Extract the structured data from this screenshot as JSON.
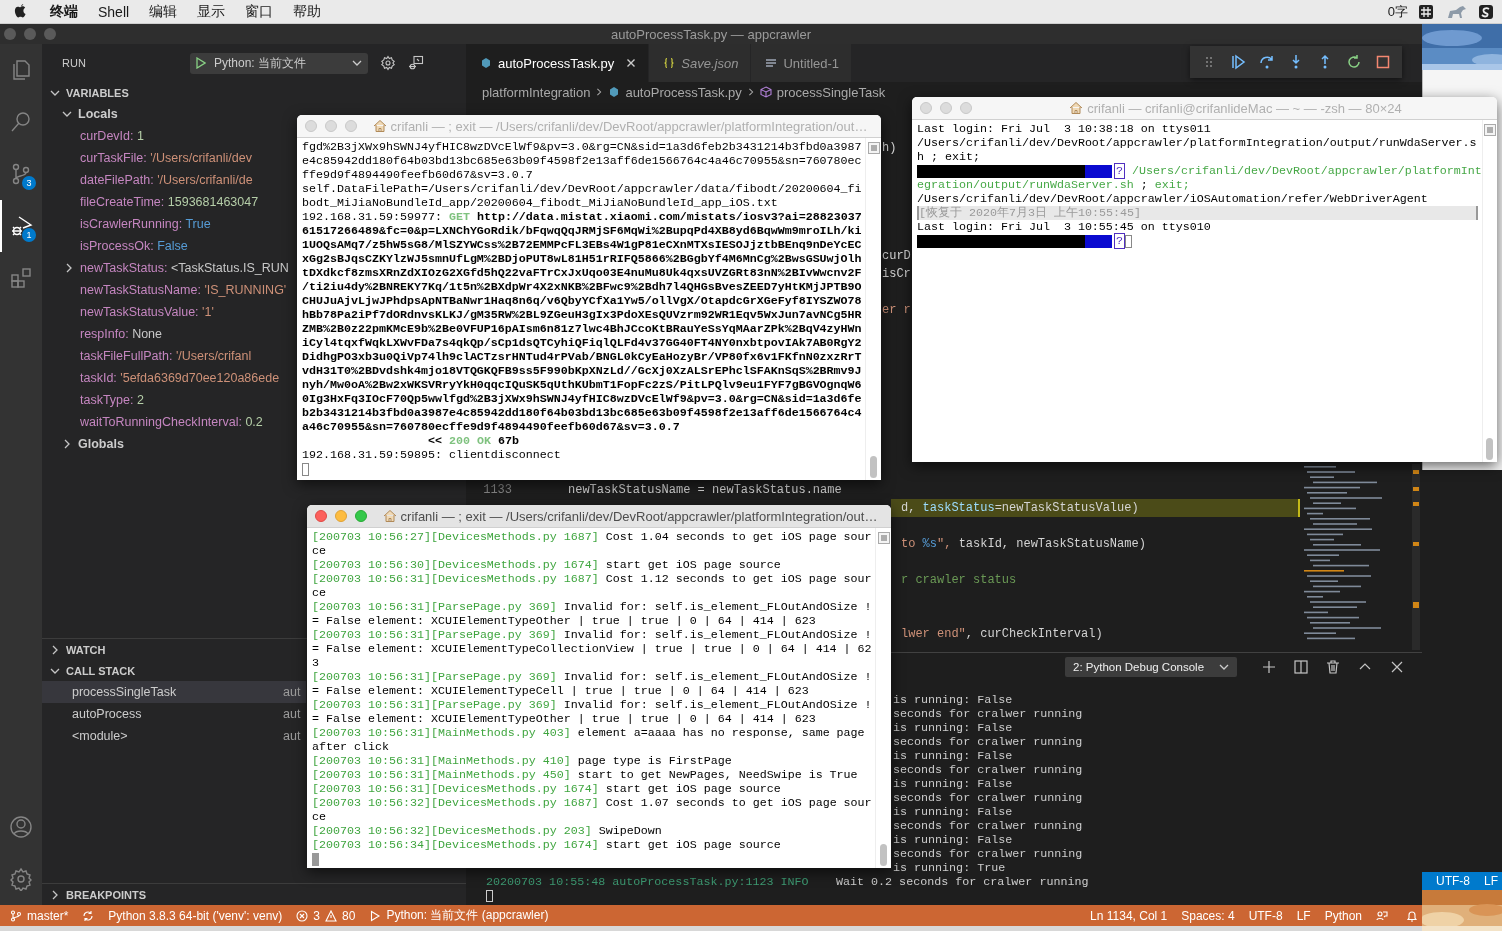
{
  "menu_bar": {
    "app": "终端",
    "items": [
      "Shell",
      "编辑",
      "显示",
      "窗口",
      "帮助"
    ],
    "status_text": "0字"
  },
  "window": {
    "title": "autoProcessTask.py — appcrawler"
  },
  "activity_bar": {
    "items": [
      {
        "kind": "explorer",
        "selected": false
      },
      {
        "kind": "search",
        "selected": false
      },
      {
        "kind": "source-control",
        "badge": "3",
        "selected": false
      },
      {
        "kind": "debug",
        "badge": "1",
        "selected": true
      },
      {
        "kind": "extensions",
        "selected": false
      }
    ],
    "bottom": [
      {
        "kind": "account"
      },
      {
        "kind": "settings"
      }
    ]
  },
  "sidebar": {
    "title": "RUN",
    "launch_config": "Python: 当前文件",
    "variables": {
      "title": "VARIABLES",
      "expanded": true,
      "scopes": [
        {
          "name": "Locals",
          "expanded": true,
          "variables": [
            {
              "name": "curDevId:",
              "value": "1",
              "kind": "number",
              "expandable": false
            },
            {
              "name": "curTaskFile:",
              "value": "'/Users/crifanli/dev",
              "kind": "string",
              "expandable": false
            },
            {
              "name": "dateFilePath:",
              "value": "'/Users/crifanli/de",
              "kind": "string",
              "expandable": false
            },
            {
              "name": "fileCreateTime:",
              "value": "1593681463047",
              "kind": "number",
              "expandable": false
            },
            {
              "name": "isCrawlerRunning:",
              "value": "True",
              "kind": "boolean",
              "expandable": false
            },
            {
              "name": "isProcessOk:",
              "value": "False",
              "kind": "boolean",
              "expandable": false
            },
            {
              "name": "newTaskStatus:",
              "value": "<TaskStatus.IS_RUN",
              "kind": "object",
              "expandable": true,
              "expanded": false
            },
            {
              "name": "newTaskStatusName:",
              "value": "'IS_RUNNING'",
              "kind": "string",
              "expandable": false
            },
            {
              "name": "newTaskStatusValue:",
              "value": "'1'",
              "kind": "string",
              "expandable": false
            },
            {
              "name": "respInfo:",
              "value": "None",
              "kind": "none",
              "expandable": false
            },
            {
              "name": "taskFileFullPath:",
              "value": "'/Users/crifanl",
              "kind": "string",
              "expandable": false
            },
            {
              "name": "taskId:",
              "value": "'5efda6369d70ee120a86ede",
              "kind": "string",
              "expandable": false
            },
            {
              "name": "taskType:",
              "value": "2",
              "kind": "number",
              "expandable": false
            },
            {
              "name": "waitToRunningCheckInterval:",
              "value": "0.2",
              "kind": "number",
              "expandable": false
            }
          ]
        },
        {
          "name": "Globals",
          "expanded": false
        }
      ]
    },
    "watch": {
      "title": "WATCH",
      "expanded": false
    },
    "call_stack": {
      "title": "CALL STACK",
      "expanded": true,
      "frames": [
        {
          "name": "processSingleTask",
          "source": "aut",
          "selected": true
        },
        {
          "name": "autoProcess",
          "source": "aut",
          "selected": false
        },
        {
          "name": "<module>",
          "source": "aut",
          "selected": false
        }
      ]
    },
    "breakpoints": {
      "title": "BREAKPOINTS",
      "expanded": false
    }
  },
  "editor": {
    "tabs": [
      {
        "label": "autoProcessTask.py",
        "kind": "python",
        "selected": true,
        "preview": false
      },
      {
        "label": "Save.json",
        "kind": "json",
        "selected": false,
        "preview": true
      },
      {
        "label": "Untitled-1",
        "kind": "text",
        "selected": false,
        "preview": false
      }
    ],
    "breadcrumb": [
      {
        "label": "platformIntegration",
        "kind": "folder"
      },
      {
        "label": "autoProcessTask.py",
        "kind": "python"
      },
      {
        "label": "processSingleTask",
        "kind": "method"
      }
    ],
    "debug_toolbar": [
      {
        "kind": "grip"
      },
      {
        "kind": "continue"
      },
      {
        "kind": "step-over"
      },
      {
        "kind": "step-into"
      },
      {
        "kind": "step-out"
      },
      {
        "kind": "restart"
      },
      {
        "kind": "stop"
      }
    ],
    "code_lines": [
      {
        "highlighted": false,
        "segments": [
          {
            "text": "h)",
            "kind": "plain"
          }
        ]
      },
      {
        "highlighted": false,
        "segments": [
          {
            "text": "curD",
            "kind": "plain"
          }
        ]
      },
      {
        "highlighted": false,
        "segments": [
          {
            "text": "isCr",
            "kind": "plain"
          }
        ]
      },
      {
        "highlighted": false,
        "segments": [
          {
            "text": "er r",
            "kind": "string"
          }
        ]
      },
      {
        "number": "1133",
        "highlighted": false,
        "segments": [
          {
            "text": "newTaskStatusName = newTaskStatus.name",
            "kind": "plain"
          }
        ]
      },
      {
        "highlighted": true,
        "segments": [
          {
            "text": "d, ",
            "kind": "plain"
          },
          {
            "text": "taskStatus",
            "kind": "param"
          },
          {
            "text": "=newTaskStatusValue)",
            "kind": "plain"
          }
        ]
      },
      {
        "highlighted": false,
        "segments": [
          {
            "text": "to ",
            "kind": "string"
          },
          {
            "text": "%s",
            "kind": "format"
          },
          {
            "text": "\", ",
            "kind": "string"
          },
          {
            "text": "taskId, newTaskStatusName)",
            "kind": "plain"
          }
        ]
      },
      {
        "highlighted": false,
        "segments": [
          {
            "text": "r crawler status",
            "kind": "comment"
          }
        ]
      },
      {
        "highlighted": false,
        "segments": [
          {
            "text": "lwer end\"",
            "kind": "string"
          },
          {
            "text": ", curCheckInterval)",
            "kind": "plain"
          }
        ]
      }
    ]
  },
  "panel": {
    "console_select": "2: Python Debug Console",
    "actions": [
      {
        "kind": "add"
      },
      {
        "kind": "split"
      },
      {
        "kind": "trash"
      },
      {
        "kind": "maximize"
      },
      {
        "kind": "close"
      }
    ],
    "visible_fragments": [
      "is running: False",
      "seconds for cralwer running",
      "is running: False",
      "seconds for cralwer running",
      "is running: False",
      "seconds for cralwer running",
      "is running: False",
      "seconds for cralwer running",
      "is running: False",
      "seconds for cralwer running",
      "is running: False",
      "seconds for cralwer running",
      "is running: True"
    ],
    "lines": [
      {
        "meta": "20200703 10:55:48 autoProcessTask.py:1123 INFO",
        "text": "Wait 0.2 seconds for cralwer running"
      }
    ],
    "cursor": true
  },
  "status_bar": {
    "left": [
      {
        "kind": "branch",
        "text": "master*"
      },
      {
        "kind": "sync"
      },
      {
        "kind": "interpreter",
        "text": "Python 3.8.3 64-bit ('venv': venv)"
      },
      {
        "kind": "problems",
        "errors": "3",
        "warnings": "80"
      },
      {
        "kind": "launch",
        "text": "Python: 当前文件 (appcrawler)"
      }
    ],
    "right": [
      {
        "kind": "text",
        "text": "Ln 1134, Col 1"
      },
      {
        "kind": "text",
        "text": "Spaces: 4"
      },
      {
        "kind": "text",
        "text": "UTF-8"
      },
      {
        "kind": "text",
        "text": "LF"
      },
      {
        "kind": "text",
        "text": "Python"
      },
      {
        "kind": "feedback"
      },
      {
        "kind": "bell"
      }
    ]
  },
  "desktop": {
    "status_texts": [
      "UTF-8",
      "LF"
    ]
  },
  "terminals": [
    {
      "title": "crifanli — ; exit — /Users/crifanli/dev/DevRoot/appcrawler/platformIntegration/out…",
      "active": false,
      "lines": [
        {
          "kind": "text",
          "segments": [
            {
              "text": "fgd%2B3jXWx9hSWNJ4yfHIC8wzDVcElWf9&pv=3.0&rg=CN&sid=1a3d6feb2b3431214b3fbd0a3987",
              "kind": "plain"
            }
          ]
        },
        {
          "kind": "text",
          "segments": [
            {
              "text": "e4c85942dd180f64b03bd13bc685e63b09f4598f2e13aff6de1566764c4a46c70955&sn=760780ec",
              "kind": "plain"
            }
          ]
        },
        {
          "kind": "text",
          "segments": [
            {
              "text": "ffe9d9f4894490feefb60d67&sv=3.0.7",
              "kind": "plain"
            }
          ]
        },
        {
          "kind": "text",
          "segments": [
            {
              "text": "self.DataFilePath=/Users/crifanli/dev/DevRoot/appcrawler/data/fibodt/20200604_fi",
              "kind": "plain"
            }
          ]
        },
        {
          "kind": "text",
          "segments": [
            {
              "text": "bodt_MiJiaNoBundleId_app/20200604_fibodt_MiJiaNoBundleId_app_iOS.txt",
              "kind": "plain"
            }
          ]
        },
        {
          "kind": "text",
          "segments": [
            {
              "text": "192.168.31.59:59977: ",
              "kind": "plain"
            },
            {
              "text": "GET",
              "kind": "method"
            },
            {
              "text": " http://data.mistat.xiaomi.com/mistats/iosv3?ai=28823037",
              "kind": "url"
            }
          ]
        },
        {
          "kind": "text",
          "segments": [
            {
              "text": "61517266489&fc=0&p=LXNChYGoRdik/bFqwqQqJRMjSF6MqWi%2BupqPd4XB8yd6BqwWm9mroILh/ki",
              "kind": "url"
            }
          ]
        },
        {
          "kind": "text",
          "segments": [
            {
              "text": "1UOQsAMq7/z5hW5sG8/MlSZYWCss%2B72EMMPcFL3EBs4W1gP81eCXnMTXsIESOJjztbBEnq9nDeYcEC",
              "kind": "url"
            }
          ]
        },
        {
          "kind": "text",
          "segments": [
            {
              "text": "xGg2sBJqsCZKYlzWJ5smnUfLgM%2BDjoPUT8wL81H51rRIFQ5866%2BGgbYf4M6MnCg%2BwsGSUwjOlh",
              "kind": "url"
            }
          ]
        },
        {
          "kind": "text",
          "segments": [
            {
              "text": "tDXdkcf8zmsXRnZdXIOzG2XGfd5hQ22vaFTrCxJxUqo03E4nuMu8Uk4qxsUVZGRt83nN%2BIvWwcnv2F",
              "kind": "url"
            }
          ]
        },
        {
          "kind": "text",
          "segments": [
            {
              "text": "/ti2iu4dy%2BNREKY7Kq/1t5n%2BXdpWr4X2xNKB%2BFwc9%2Bdh7l4QHGsBvesZEED7yHtKMjJPTB9O",
              "kind": "url"
            }
          ]
        },
        {
          "kind": "text",
          "segments": [
            {
              "text": "CHUJuAjvLjwJPhdpsApNTBaNwr1Haq8n6q/v6QbyYCfXa1Yw5/ollVgX/OtapdcGrXGeFyf8IYSZWO78",
              "kind": "url"
            }
          ]
        },
        {
          "kind": "text",
          "segments": [
            {
              "text": "hBb78Pa2iPf7dORdnvsKLKJ/gM35RW%2BL9ZGeuH3gIx3PdoXEsQUVzrm92WR1Eqv5WxJun7avNCg5HR",
              "kind": "url"
            }
          ]
        },
        {
          "kind": "text",
          "segments": [
            {
              "text": "ZMB%2B0z22pmKMcE9b%2Be0VFUP16pAIsm6n81z7lwc4BhJCcoKtBRauYeSsYqMAarZPk%2BqV4zyHWn",
              "kind": "url"
            }
          ]
        },
        {
          "kind": "text",
          "segments": [
            {
              "text": "iCyl4tqxfWqkLXWvFDa7s4qkQp/sCp1dsQTCyhiQFiqlQLFd4v37GG40FT4NY0nxbtpovIAk7AB0RgY2",
              "kind": "url"
            }
          ]
        },
        {
          "kind": "text",
          "segments": [
            {
              "text": "DidhgPO3xb3u0QiVp74lh9clACTzsrHNTud4rPVab/BNGL0kCyEaHozyBr/VP80fx6v1FKfnN0zxzRrT",
              "kind": "url"
            }
          ]
        },
        {
          "kind": "text",
          "segments": [
            {
              "text": "vdH31T0%2BDvdshk4mjo18VTQGKQFB9ss5F990bKpXNzLd//GcXj0XzALSrEPhclSFAKnSqS%2BRmv9J",
              "kind": "url"
            }
          ]
        },
        {
          "kind": "text",
          "segments": [
            {
              "text": "nyh/Mw0oA%2Bw2xWKSVRryYkH0qqcIQuSK5qUthKUbmT1FopFc2zS/PitLPQlv9eu1FYF7gBGVOgnqW6",
              "kind": "url"
            }
          ]
        },
        {
          "kind": "text",
          "segments": [
            {
              "text": "0Ig3HxFq3IOcF70Qp5wwlfgd%2B3jXWx9hSWNJ4yfHIC8wzDVcElWf9&pv=3.0&rg=CN&sid=1a3d6fe",
              "kind": "url"
            }
          ]
        },
        {
          "kind": "text",
          "segments": [
            {
              "text": "b2b3431214b3fbd0a3987e4c85942dd180f64b03bd13bc685e63b09f4598f2e13aff6de1566764c4",
              "kind": "url"
            }
          ]
        },
        {
          "kind": "text",
          "segments": [
            {
              "text": "a46c70955&sn=760780ecffe9d9f4894490feefb60d67&sv=3.0.7",
              "kind": "url"
            }
          ]
        },
        {
          "kind": "response",
          "segments": [
            {
              "text": "<< ",
              "kind": "url"
            },
            {
              "text": "200 OK",
              "kind": "method"
            },
            {
              "text": " 67b",
              "kind": "url"
            }
          ]
        },
        {
          "kind": "text",
          "segments": [
            {
              "text": "192.168.31.59:59895: clientdisconnect",
              "kind": "plain"
            }
          ]
        },
        {
          "kind": "cursor"
        }
      ]
    },
    {
      "title": "crifanli — ; exit — /Users/crifanli/dev/DevRoot/appcrawler/platformIntegration/out…",
      "active": true,
      "lines": [
        {
          "kind": "text",
          "segments": [
            {
              "text": "[200703 10:56:27][DevicesMethods.py 1687]",
              "kind": "log-prefix"
            },
            {
              "text": " Cost 1.04 seconds to get iOS page sour",
              "kind": "plain"
            }
          ]
        },
        {
          "kind": "text",
          "segments": [
            {
              "text": "ce",
              "kind": "plain"
            }
          ]
        },
        {
          "kind": "text",
          "segments": [
            {
              "text": "[200703 10:56:30][DevicesMethods.py 1674]",
              "kind": "log-prefix"
            },
            {
              "text": " start get iOS page source",
              "kind": "plain"
            }
          ]
        },
        {
          "kind": "text",
          "segments": [
            {
              "text": "[200703 10:56:31][DevicesMethods.py 1687]",
              "kind": "log-prefix"
            },
            {
              "text": " Cost 1.12 seconds to get iOS page sour",
              "kind": "plain"
            }
          ]
        },
        {
          "kind": "text",
          "segments": [
            {
              "text": "ce",
              "kind": "plain"
            }
          ]
        },
        {
          "kind": "text",
          "segments": [
            {
              "text": "[200703 10:56:31][ParsePage.py 369]",
              "kind": "log-prefix"
            },
            {
              "text": " Invalid for: self.is_element_FLOutAndOSize !",
              "kind": "plain"
            }
          ]
        },
        {
          "kind": "text",
          "segments": [
            {
              "text": "= False element: XCUIElementTypeOther | true | true | 0 | 64 | 414 | 623",
              "kind": "plain"
            }
          ]
        },
        {
          "kind": "text",
          "segments": [
            {
              "text": "[200703 10:56:31][ParsePage.py 369]",
              "kind": "log-prefix"
            },
            {
              "text": " Invalid for: self.is_element_FLOutAndOSize !",
              "kind": "plain"
            }
          ]
        },
        {
          "kind": "text",
          "segments": [
            {
              "text": "= False element: XCUIElementTypeCollectionView | true | true | 0 | 64 | 414 | 62",
              "kind": "plain"
            }
          ]
        },
        {
          "kind": "text",
          "segments": [
            {
              "text": "3",
              "kind": "plain"
            }
          ]
        },
        {
          "kind": "text",
          "segments": [
            {
              "text": "[200703 10:56:31][ParsePage.py 369]",
              "kind": "log-prefix"
            },
            {
              "text": " Invalid for: self.is_element_FLOutAndOSize !",
              "kind": "plain"
            }
          ]
        },
        {
          "kind": "text",
          "segments": [
            {
              "text": "= False element: XCUIElementTypeCell | true | true | 0 | 64 | 414 | 623",
              "kind": "plain"
            }
          ]
        },
        {
          "kind": "text",
          "segments": [
            {
              "text": "[200703 10:56:31][ParsePage.py 369]",
              "kind": "log-prefix"
            },
            {
              "text": " Invalid for: self.is_element_FLOutAndOSize !",
              "kind": "plain"
            }
          ]
        },
        {
          "kind": "text",
          "segments": [
            {
              "text": "= False element: XCUIElementTypeOther | true | true | 0 | 64 | 414 | 623",
              "kind": "plain"
            }
          ]
        },
        {
          "kind": "text",
          "segments": [
            {
              "text": "[200703 10:56:31][MainMethods.py 403]",
              "kind": "log-prefix"
            },
            {
              "text": " element a=aaaa has no response, same page",
              "kind": "plain"
            }
          ]
        },
        {
          "kind": "text",
          "segments": [
            {
              "text": "after click",
              "kind": "plain"
            }
          ]
        },
        {
          "kind": "text",
          "segments": [
            {
              "text": "[200703 10:56:31][MainMethods.py 410]",
              "kind": "log-prefix"
            },
            {
              "text": " page type is FirstPage",
              "kind": "plain"
            }
          ]
        },
        {
          "kind": "text",
          "segments": [
            {
              "text": "[200703 10:56:31][MainMethods.py 450]",
              "kind": "log-prefix"
            },
            {
              "text": " start to get NewPages, NeedSwipe is True",
              "kind": "plain"
            }
          ]
        },
        {
          "kind": "text",
          "segments": [
            {
              "text": "[200703 10:56:31][DevicesMethods.py 1674]",
              "kind": "log-prefix"
            },
            {
              "text": " start get iOS page source",
              "kind": "plain"
            }
          ]
        },
        {
          "kind": "text",
          "segments": [
            {
              "text": "[200703 10:56:32][DevicesMethods.py 1687]",
              "kind": "log-prefix"
            },
            {
              "text": " Cost 1.07 seconds to get iOS page sour",
              "kind": "plain"
            }
          ]
        },
        {
          "kind": "text",
          "segments": [
            {
              "text": "ce",
              "kind": "plain"
            }
          ]
        },
        {
          "kind": "text",
          "segments": [
            {
              "text": "[200703 10:56:32][DevicesMethods.py 203]",
              "kind": "log-prefix"
            },
            {
              "text": " SwipeDown",
              "kind": "plain"
            }
          ]
        },
        {
          "kind": "text",
          "segments": [
            {
              "text": "[200703 10:56:34][DevicesMethods.py 1674]",
              "kind": "log-prefix"
            },
            {
              "text": " start get iOS page source",
              "kind": "plain"
            }
          ]
        },
        {
          "kind": "cursor"
        }
      ]
    },
    {
      "title": "crifanli — crifanli@crifanlideMac — ~ — -zsh — 80×24",
      "active": false,
      "lines": [
        {
          "kind": "text",
          "segments": [
            {
              "text": "Last login: Fri Jul  3 10:38:18 on ttys011",
              "kind": "plain"
            }
          ]
        },
        {
          "kind": "text",
          "segments": [
            {
              "text": "/Users/crifanli/dev/DevRoot/appcrawler/platformIntegration/output/runWdaServer.s",
              "kind": "plain"
            }
          ]
        },
        {
          "kind": "text",
          "segments": [
            {
              "text": "h ; exit;",
              "kind": "plain"
            }
          ]
        },
        {
          "kind": "prompt",
          "segments": [
            {
              "text": "?",
              "kind": "glyph"
            },
            {
              "text": " /Users/crifanli/dev/DevRoot/appcrawler/platformInt",
              "kind": "path"
            }
          ]
        },
        {
          "kind": "text",
          "segments": [
            {
              "text": "egration/output/runWdaServer.sh",
              "kind": "path"
            },
            {
              "text": " ; ",
              "kind": "plain"
            },
            {
              "text": "exit;",
              "kind": "path"
            }
          ]
        },
        {
          "kind": "text",
          "segments": [
            {
              "text": "/Users/crifanli/dev/DevRoot/appcrawler/iOSAutomation/refer/WebDriverAgent",
              "kind": "plain"
            }
          ]
        },
        {
          "kind": "restored",
          "segments": [
            {
              "text": "[恢复于 2020年7月3日 上午10:55:45]",
              "kind": "note"
            }
          ]
        },
        {
          "kind": "text",
          "segments": [
            {
              "text": "Last login: Fri Jul  3 10:55:45 on ttys010",
              "kind": "plain"
            }
          ]
        },
        {
          "kind": "prompt",
          "cursor": true,
          "segments": [
            {
              "text": "?",
              "kind": "glyph"
            }
          ]
        }
      ]
    }
  ]
}
